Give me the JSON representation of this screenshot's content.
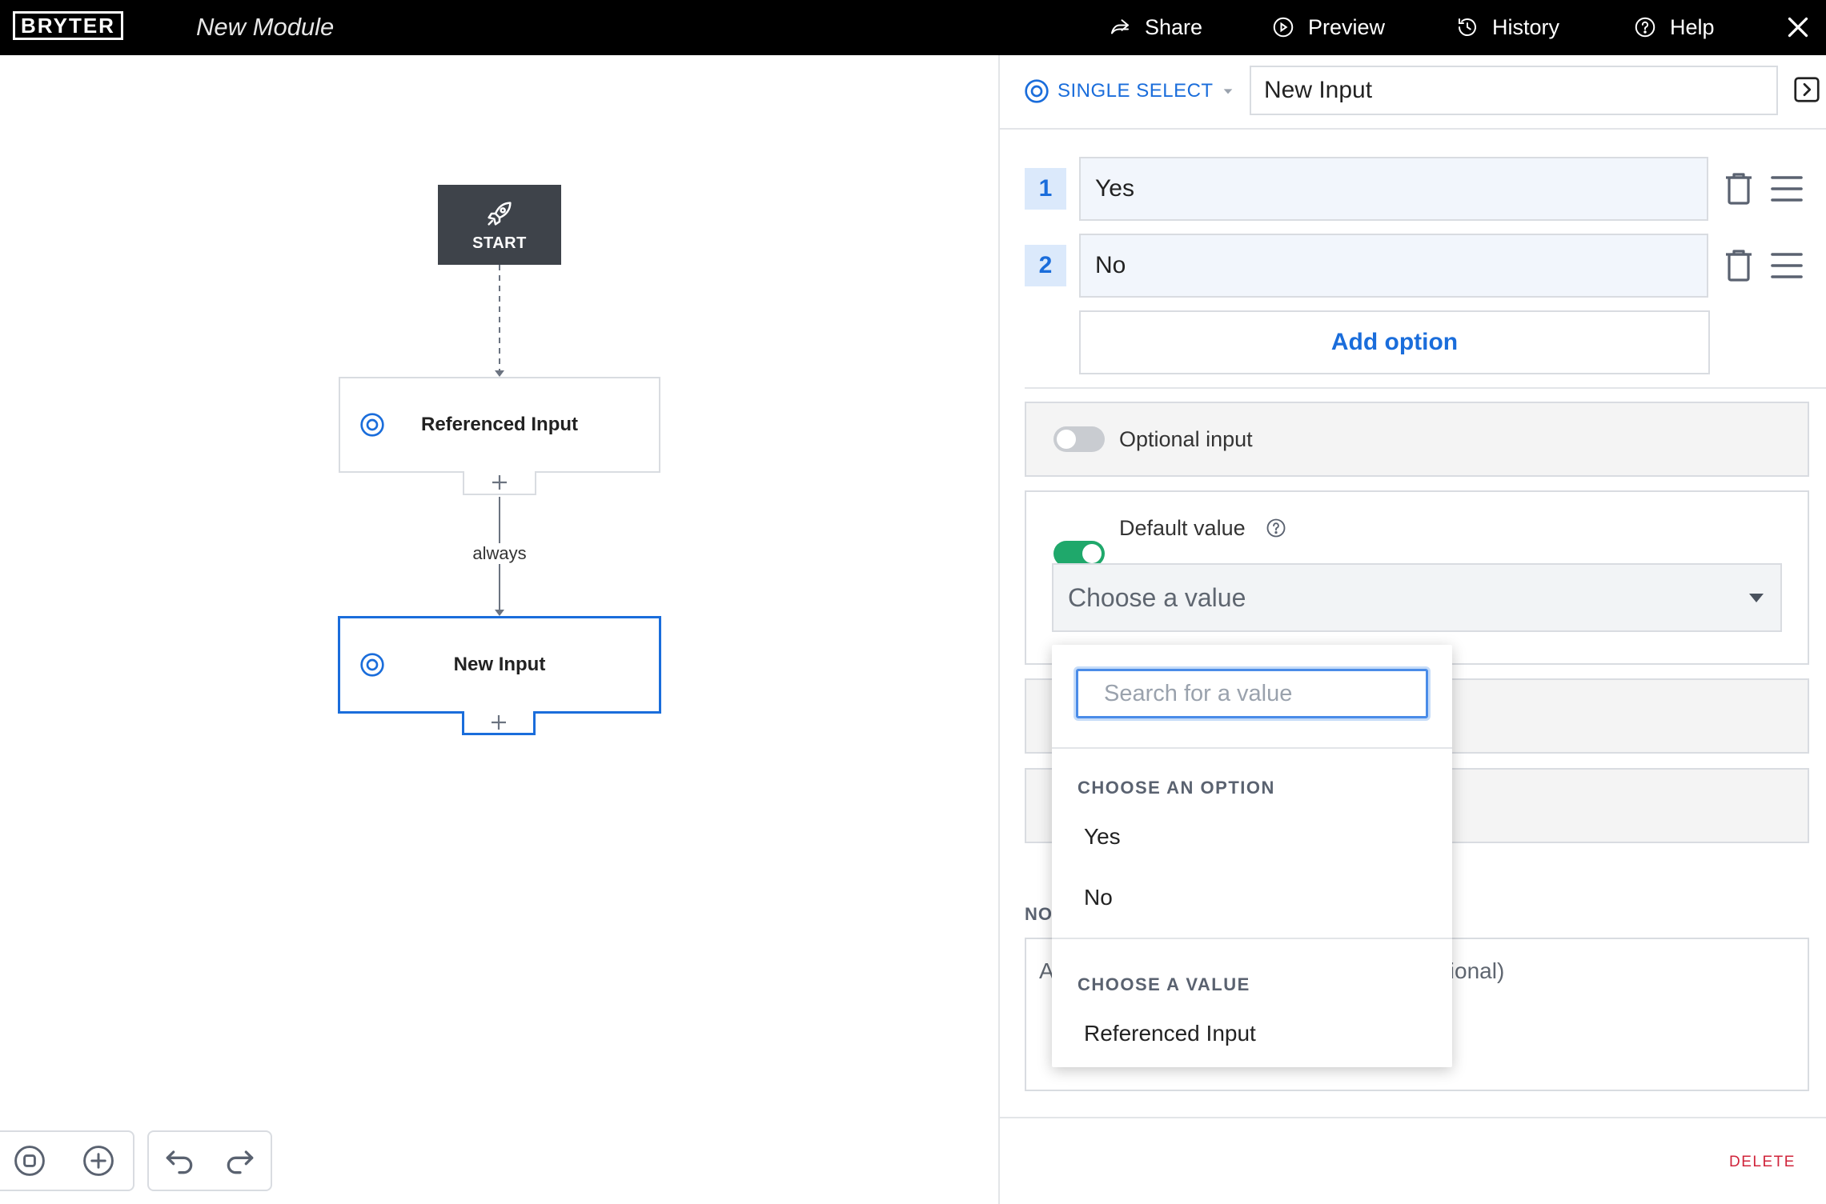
{
  "app": {
    "logo_text": "BRYTER",
    "module_title": "New Module"
  },
  "topbar": {
    "share_label": "Share",
    "preview_label": "Preview",
    "history_label": "History",
    "help_label": "Help",
    "icons": {
      "share": "share-arrow-icon",
      "preview": "play-circle-icon",
      "history": "history-clock-icon",
      "help": "question-circle-icon",
      "close": "close-icon"
    }
  },
  "canvas": {
    "start_label": "START",
    "nodes": [
      {
        "label": "Referenced Input",
        "selected": false
      },
      {
        "label": "New Input",
        "selected": true
      }
    ],
    "edge_label": "always",
    "plus_symbol": "+",
    "tools": [
      "zoom-fit-icon",
      "zoom-in-icon",
      "undo-icon",
      "redo-icon"
    ]
  },
  "panel": {
    "type_label": "SINGLE SELECT",
    "input_name": "New Input",
    "options": [
      {
        "number": "1",
        "value": "Yes"
      },
      {
        "number": "2",
        "value": "No"
      }
    ],
    "add_option_label": "Add option",
    "optional_input_label": "Optional input",
    "optional_input_enabled": false,
    "default_value_label": "Default value",
    "default_value_enabled": true,
    "default_value_placeholder": "Choose a value",
    "notes_heading_fragment": "NO",
    "notes_placeholder_start": "A",
    "notes_placeholder_end": "tional)",
    "delete_label": "DELETE"
  },
  "dropdown": {
    "search_placeholder": "Search for a value",
    "groups": [
      {
        "heading": "CHOOSE AN OPTION",
        "items": [
          "Yes",
          "No"
        ]
      },
      {
        "heading": "CHOOSE A VALUE",
        "items": [
          "Referenced Input"
        ]
      }
    ]
  },
  "colors": {
    "accent_blue": "#1a6ddb",
    "toggle_on": "#1fa86b",
    "toggle_off": "#c9ccd1",
    "delete_red": "#d0243b",
    "start_node_bg": "#3e434a",
    "topbar_bg": "#000000"
  }
}
